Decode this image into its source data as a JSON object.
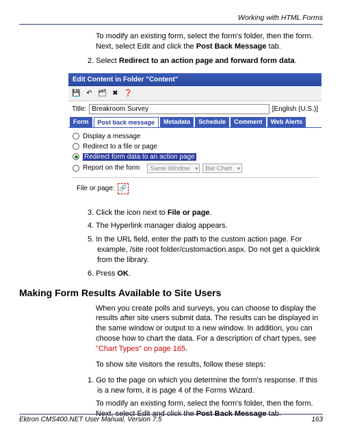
{
  "header": {
    "right": "Working with HTML Forms"
  },
  "intro": "To modify an existing form, select the form's folder, then the form. Next, select Edit and click the ",
  "intro_bold": "Post Back Message",
  "intro_tail": " tab.",
  "step2": {
    "num": "2.",
    "text": "Select ",
    "bold": "Redirect to an action page and forward form data",
    "tail": "."
  },
  "window": {
    "title": "Edit Content in Folder \"Content\"",
    "icons": {
      "save": "save-icon",
      "undo": "undo-icon",
      "refresh": "refresh-icon",
      "delete": "delete-icon",
      "help": "help-icon"
    },
    "title_label": "Title:",
    "title_value": "Breakroom Survey",
    "language": "[English (U.S.)]",
    "tabs": [
      "Form",
      "Post back message",
      "Metadata",
      "Schedule",
      "Comment",
      "Web Alerts"
    ],
    "active_tab": 1,
    "radios": {
      "display": "Display a message",
      "redirect_file": "Redirect to a file or page",
      "redirect_action": "Redirect form data to an action page",
      "report": "Report on the form",
      "select1": "Same Window",
      "select2": "Bar Chart"
    },
    "file_page_label": "File or page:"
  },
  "steps_after": {
    "s3": {
      "num": "3.",
      "text": "Click the icon next to ",
      "bold": "File or page",
      "tail": "."
    },
    "s4": {
      "num": "4.",
      "text": "The Hyperlink manager dialog appears."
    },
    "s5": {
      "num": "5.",
      "text": "In the URL field, enter the path to the custom action page. For example, /site root folder/customaction.aspx. Do not get a quicklink from the library."
    },
    "s6": {
      "num": "6.",
      "text": "Press ",
      "bold": "OK",
      "tail": "."
    }
  },
  "h2": "Making Form Results Available to Site Users",
  "para1": {
    "text": "When you create polls and surveys, you can choose to display the results after site users submit data. The results can be displayed in the same window or output to a new window. In addition, you can choose how to chart the data. For a description of chart types, see ",
    "link": "\"Chart Types\" on page 165",
    "tail": "."
  },
  "para2": "To show site visitors the results, follow these steps:",
  "step_b1": {
    "num": "1.",
    "text": "Go to the page on which you determine the form's response. If this is a new form, it is page 4 of the Forms Wizard.",
    "text2a": "To modify an existing form, select the form's folder, then the form. Next, select Edit and click the ",
    "bold": "Post Back Message",
    "text2b": " tab."
  },
  "footer": {
    "left": "Ektron CMS400.NET User Manual, Version 7.5",
    "right": "163"
  }
}
